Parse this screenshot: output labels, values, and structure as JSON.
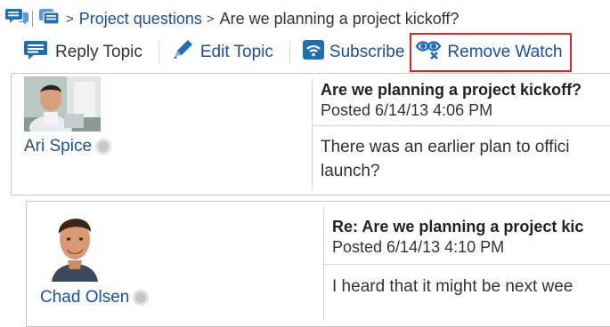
{
  "breadcrumb": {
    "parent": "Project questions",
    "current": "Are we planning a project kickoff?"
  },
  "toolbar": {
    "reply": "Reply Topic",
    "edit": "Edit Topic",
    "subscribe": "Subscribe",
    "remove_watch": "Remove Watch"
  },
  "posts": [
    {
      "author": "Ari Spice",
      "title": "Are we planning a project kickoff?",
      "posted": "Posted 6/14/13 4:06 PM",
      "body_line1": "There was an earlier plan to offici",
      "body_line2": "launch?"
    },
    {
      "author": "Chad Olsen",
      "title": "Re: Are we planning a project kic",
      "posted": "Posted 6/14/13 4:10 PM",
      "body_line1": "I heard that it might be next wee"
    }
  ],
  "colors": {
    "link": "#1a4f9c",
    "highlight_border": "#d62a2a",
    "icon_blue": "#1f6fb2"
  },
  "icons": [
    "discussion-icon",
    "forum-icon",
    "reply-icon",
    "pencil-icon",
    "subscribe-icon",
    "remove-watch-icon",
    "presence-icon"
  ]
}
